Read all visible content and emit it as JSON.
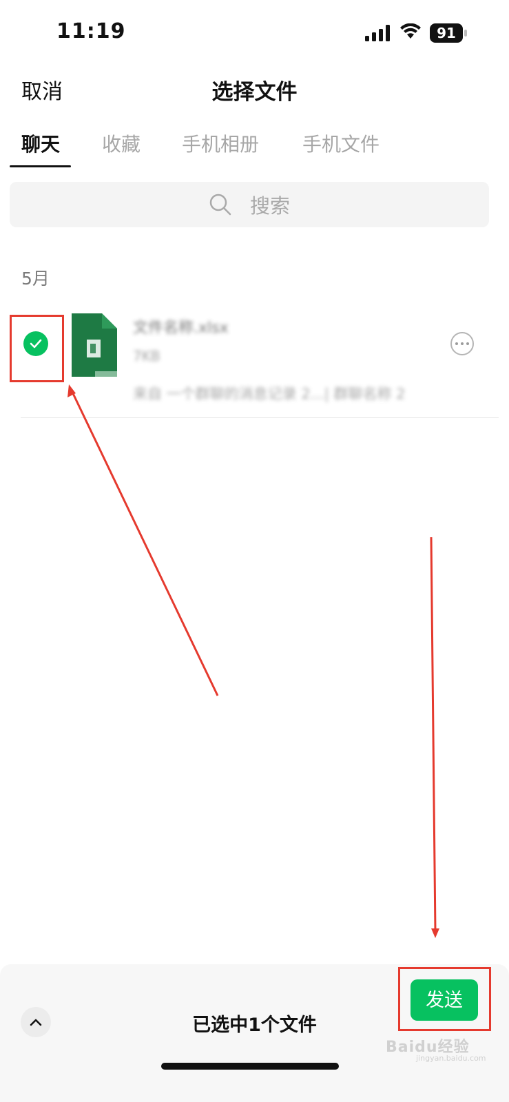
{
  "status_bar": {
    "time": "11:19",
    "battery": "91"
  },
  "header": {
    "cancel_label": "取消",
    "title": "选择文件"
  },
  "tabs": [
    {
      "label": "聊天",
      "active": true
    },
    {
      "label": "收藏",
      "active": false
    },
    {
      "label": "手机相册",
      "active": false
    },
    {
      "label": "手机文件",
      "active": false
    }
  ],
  "search": {
    "placeholder": "搜索"
  },
  "sections": [
    {
      "label": "5月",
      "files": [
        {
          "name": "文件名称.xlsx",
          "size": "7KB",
          "source": "来自 一个群聊的消息记录 2...| 群聊名称 2",
          "selected": true,
          "icon": "excel-file-icon"
        }
      ]
    }
  ],
  "footer": {
    "selected_text": "已选中1个文件",
    "send_label": "发送"
  },
  "watermark": {
    "text": "Baidu经验",
    "sub": "jingyan.baidu.com"
  },
  "colors": {
    "accent": "#07c160",
    "annotation": "#e53a2e",
    "excel": "#1e7a44"
  }
}
